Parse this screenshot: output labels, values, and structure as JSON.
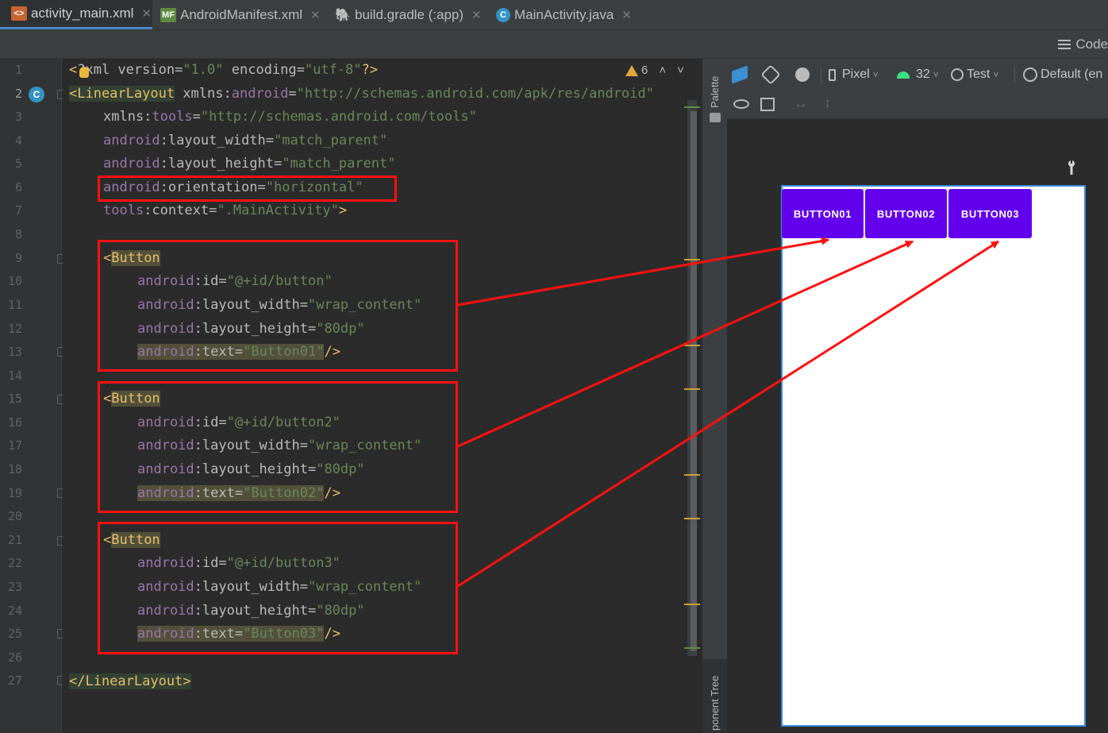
{
  "tabs": [
    {
      "label": "activity_main.xml",
      "icon": "xml-layout-icon",
      "active": true
    },
    {
      "label": "AndroidManifest.xml",
      "icon": "manifest-icon",
      "active": false
    },
    {
      "label": "build.gradle (:app)",
      "icon": "gradle-icon",
      "active": false
    },
    {
      "label": "MainActivity.java",
      "icon": "java-class-icon",
      "active": false
    }
  ],
  "view_mode": {
    "code_label": "Code"
  },
  "inspections": {
    "warnings": "6"
  },
  "line_numbers": [
    "1",
    "2",
    "3",
    "4",
    "5",
    "6",
    "7",
    "8",
    "9",
    "10",
    "11",
    "12",
    "13",
    "14",
    "15",
    "16",
    "17",
    "18",
    "19",
    "20",
    "21",
    "22",
    "23",
    "24",
    "25",
    "26",
    "27"
  ],
  "gutter_badge": "C",
  "code": {
    "l1": {
      "a": "<",
      "b": "?xml version=",
      "c": "\"1.0\"",
      "d": " encoding=",
      "e": "\"utf-8\"",
      "f": "?>"
    },
    "l2": {
      "tag": "<LinearLayout",
      "attr": " xmlns:",
      "ns": "android",
      "eq": "=",
      "val": "\"http://schemas.android.com/apk/res/android\""
    },
    "l3": {
      "attr": "xmlns:",
      "ns": "tools",
      "eq": "=",
      "val": "\"http://schemas.android.com/tools\""
    },
    "l4": {
      "ns": "android",
      "attr": ":layout_width",
      "eq": "=",
      "val": "\"match_parent\""
    },
    "l5": {
      "ns": "android",
      "attr": ":layout_height",
      "eq": "=",
      "val": "\"match_parent\""
    },
    "l6": {
      "ns": "android",
      "attr": ":orientation",
      "eq": "=",
      "val": "\"horizontal\""
    },
    "l7": {
      "ns": "tools",
      "attr": ":context",
      "eq": "=",
      "val": "\".MainActivity\"",
      "end": ">"
    },
    "buttons": [
      {
        "open": "<",
        "tag": "Button",
        "ns": "android",
        "id_attr": ":id",
        "id_val": "\"@+id/button\"",
        "w_attr": ":layout_width",
        "w_val": "\"wrap_content\"",
        "h_attr": ":layout_height",
        "h_val": "\"80dp\"",
        "t_attr": ":text",
        "t_val": "\"Button01\"",
        "close": "/>",
        "eq": "="
      },
      {
        "open": "<",
        "tag": "Button",
        "ns": "android",
        "id_attr": ":id",
        "id_val": "\"@+id/button2\"",
        "w_attr": ":layout_width",
        "w_val": "\"wrap_content\"",
        "h_attr": ":layout_height",
        "h_val": "\"80dp\"",
        "t_attr": ":text",
        "t_val": "\"Button02\"",
        "close": "/>",
        "eq": "="
      },
      {
        "open": "<",
        "tag": "Button",
        "ns": "android",
        "id_attr": ":id",
        "id_val": "\"@+id/button3\"",
        "w_attr": ":layout_width",
        "w_val": "\"wrap_content\"",
        "h_attr": ":layout_height",
        "h_val": "\"80dp\"",
        "t_attr": ":text",
        "t_val": "\"Button03\"",
        "close": "/>",
        "eq": "="
      }
    ],
    "l27": {
      "tag": "</LinearLayout>"
    }
  },
  "side_panel": {
    "palette": "Palette",
    "component_tree": "ponent Tree"
  },
  "design_toolbar": {
    "device": "Pixel",
    "api": "32",
    "theme": "Test",
    "locale": "Default (en"
  },
  "preview": {
    "buttons": [
      "BUTTON01",
      "BUTTON02",
      "BUTTON03"
    ],
    "button_color": "#6200ee"
  },
  "colors": {
    "annotation": "#ff1010",
    "accent": "#4a88c7"
  }
}
